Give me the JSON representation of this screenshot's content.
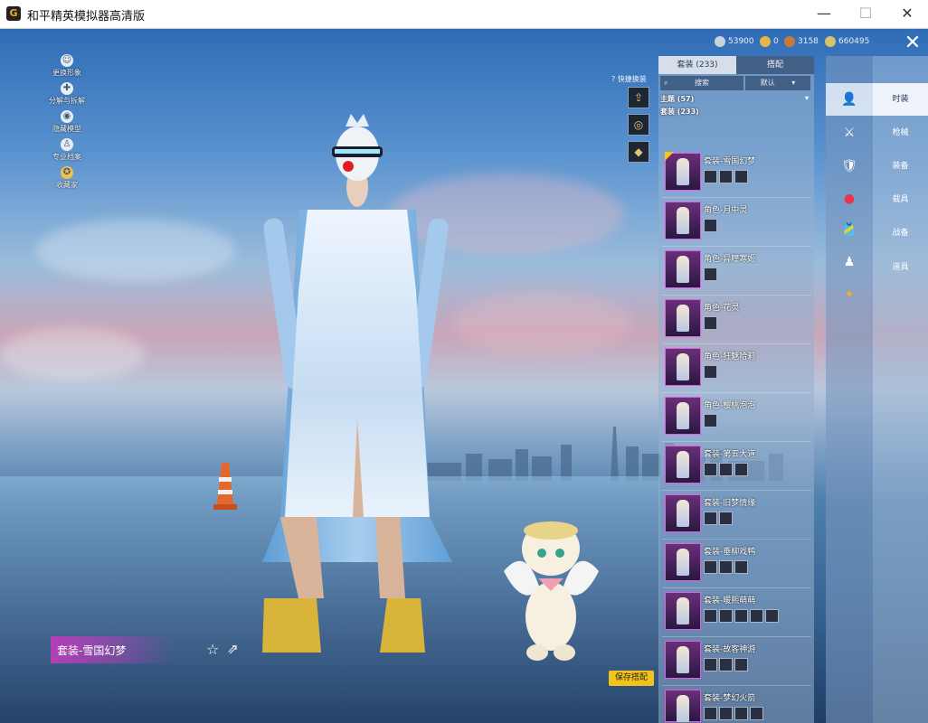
{
  "window": {
    "title": "和平精英模拟器高清版",
    "logo": "G",
    "minimize": "—",
    "maximize": "☐",
    "close": "✕"
  },
  "left_menu": [
    {
      "label": "更换形象",
      "icon": "person-icon"
    },
    {
      "label": "分解与拆解",
      "icon": "puzzle-icon"
    },
    {
      "label": "隐藏模型",
      "icon": "eye-icon"
    },
    {
      "label": "专业档案",
      "icon": "user-card-icon"
    },
    {
      "label": "收藏家",
      "icon": "collector-icon"
    }
  ],
  "currency": [
    {
      "value": "53900",
      "icon": "silver-coin-icon",
      "color": "#c9d3dd"
    },
    {
      "value": "0",
      "icon": "gold-coin-icon",
      "color": "#e3b64a"
    },
    {
      "value": "3158",
      "icon": "ticket-icon",
      "color": "#c97a3a"
    },
    {
      "value": "660495",
      "icon": "diamond-coin-icon",
      "color": "#d8c26b"
    }
  ],
  "quick_change": {
    "label": "快捷换装",
    "help_icon": "?"
  },
  "quick_buttons": [
    {
      "icon": "wardrobe-icon",
      "glyph": "⇪"
    },
    {
      "icon": "emblem-icon",
      "glyph": "◎"
    },
    {
      "icon": "diamond-icon",
      "glyph": "◆"
    }
  ],
  "outfit_name": "套装-雪国幻梦",
  "save_button": "保存搭配",
  "panel": {
    "tabs": [
      {
        "label": "套装 (233)",
        "active": true
      },
      {
        "label": "搭配",
        "active": false
      }
    ],
    "search_placeholder": "搜索",
    "sort_label": "默认",
    "sections": [
      {
        "label": "主题 (57)"
      },
      {
        "label": "套装 (233)"
      }
    ],
    "items": [
      {
        "title": "套装-雪国幻梦",
        "subs": 3,
        "selected": true
      },
      {
        "title": "角色-月中灵",
        "subs": 1
      },
      {
        "title": "角色-异瞳寒姬",
        "subs": 1
      },
      {
        "title": "角色-花灵",
        "subs": 1
      },
      {
        "title": "角色-狂魅哈莉",
        "subs": 1
      },
      {
        "title": "角色-樱桃泡泡",
        "subs": 1
      },
      {
        "title": "套装-第五大道",
        "subs": 3
      },
      {
        "title": "套装-旧梦情缘",
        "subs": 2
      },
      {
        "title": "套装-垂柳戏鸭",
        "subs": 3
      },
      {
        "title": "套装-暖熙萌萌",
        "subs": 5
      },
      {
        "title": "套装-故客神游",
        "subs": 3
      },
      {
        "title": "套装-梦幻火箭",
        "subs": 4
      }
    ]
  },
  "categories": [
    {
      "label": "时装",
      "icon": "outfit-icon",
      "glyph": "👤",
      "active": true
    },
    {
      "label": "枪械",
      "icon": "gun-icon",
      "glyph": "⚔"
    },
    {
      "label": "装备",
      "icon": "equipment-icon",
      "glyph": "🛡"
    },
    {
      "label": "载具",
      "icon": "vehicle-icon",
      "glyph": "●"
    },
    {
      "label": "战备",
      "icon": "combat-gear-icon",
      "glyph": "🎽"
    },
    {
      "label": "道具",
      "icon": "prop-icon",
      "glyph": "♟"
    },
    {
      "label": "",
      "icon": "emote-icon",
      "glyph": "✦"
    }
  ]
}
